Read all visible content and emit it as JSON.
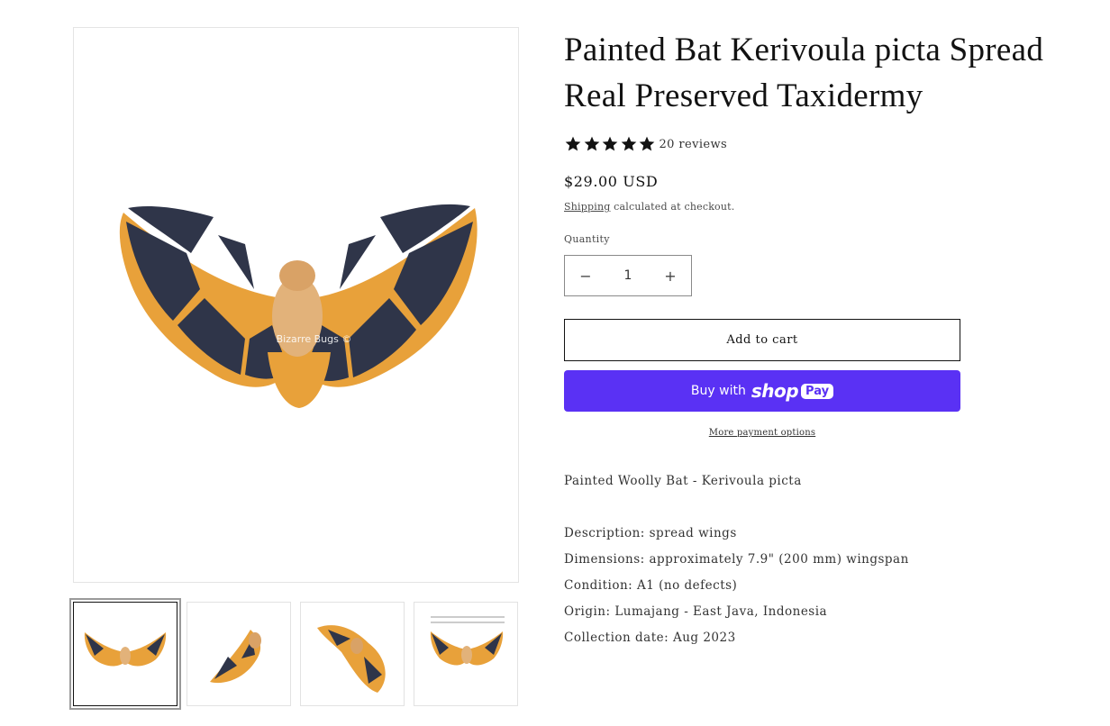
{
  "product": {
    "title": "Painted Bat Kerivoula picta Spread Real Preserved Taxidermy",
    "rating": 5,
    "reviews_label": "20 reviews",
    "price": "$29.00 USD",
    "shipping_link": "Shipping",
    "shipping_note": "calculated at checkout.",
    "quantity_label": "Quantity",
    "quantity_value": "1",
    "decrease_symbol": "−",
    "increase_symbol": "+",
    "add_to_cart": "Add to cart",
    "buy_now_prefix": "Buy with",
    "buy_now_brand": "shop",
    "buy_now_pay": "Pay",
    "more_payment": "More payment options"
  },
  "media": {
    "watermark": "Bizarre Bugs ©",
    "thumbnail_count": 4,
    "active_thumbnail": 1
  },
  "description": {
    "intro": "Painted Woolly Bat - Kerivoula picta",
    "lines": [
      "Description: spread wings",
      "Dimensions: approximately 7.9\" (200 mm) wingspan",
      "Condition: A1 (no defects)",
      "Origin: Lumajang - East Java, Indonesia",
      "Collection date: Aug 2023"
    ]
  },
  "colors": {
    "accent_shop_pay": "#5a31f4",
    "star": "#121212",
    "bat_orange": "#e89a2c",
    "bat_dark": "#2e3448"
  },
  "icons": {
    "star": "star-icon",
    "minus": "minus-icon",
    "plus": "plus-icon"
  }
}
